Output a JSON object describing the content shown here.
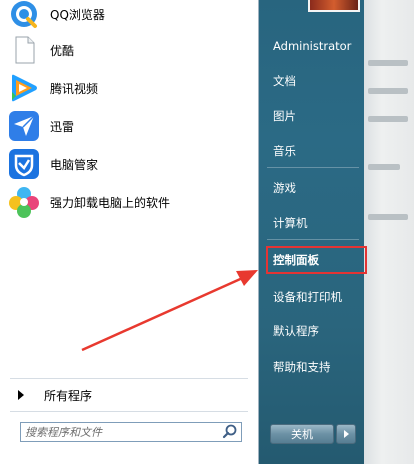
{
  "programs": [
    {
      "label": "QQ浏览器",
      "icon": "qq-browser-icon"
    },
    {
      "label": "优酷",
      "icon": "youku-file-icon"
    },
    {
      "label": "腾讯视频",
      "icon": "tencent-video-icon"
    },
    {
      "label": "迅雷",
      "icon": "xunlei-icon"
    },
    {
      "label": "电脑管家",
      "icon": "pc-manager-icon"
    },
    {
      "label": "强力卸载电脑上的软件",
      "icon": "uninstaller-icon"
    }
  ],
  "all_programs_label": "所有程序",
  "search": {
    "placeholder": "搜索程序和文件"
  },
  "right_pane": {
    "user_name": "Administrator",
    "items": [
      "文档",
      "图片",
      "音乐",
      "游戏",
      "计算机",
      "控制面板",
      "设备和打印机",
      "默认程序",
      "帮助和支持"
    ]
  },
  "shutdown": {
    "label": "关机"
  },
  "highlight_color": "#e43434",
  "arrow_color": "#e8392f"
}
